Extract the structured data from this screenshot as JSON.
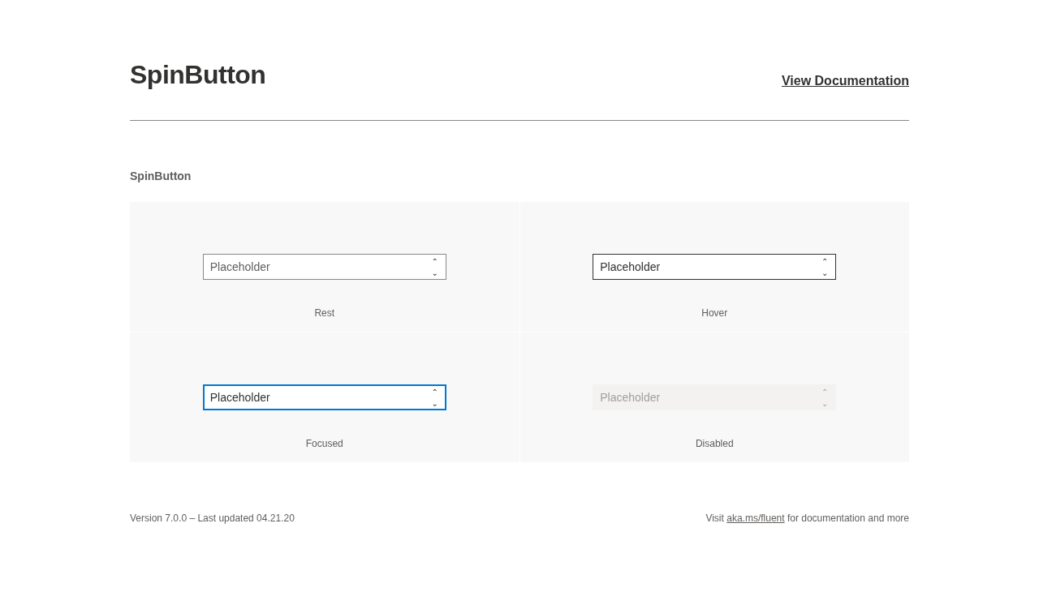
{
  "header": {
    "title": "SpinButton",
    "doc_link": "View Documentation"
  },
  "section_label": "SpinButton",
  "examples": [
    {
      "kind": "rest",
      "placeholder": "Placeholder",
      "up": "⌃",
      "down": "⌄",
      "caption": "Rest"
    },
    {
      "kind": "hover",
      "placeholder": "Placeholder",
      "up": "⌃",
      "down": "⌄",
      "caption": "Hover"
    },
    {
      "kind": "focused",
      "placeholder": "Placeholder",
      "up": "⌃",
      "down": "⌄",
      "caption": "Focused"
    },
    {
      "kind": "disabled",
      "placeholder": "Placeholder",
      "up": "⌃",
      "down": "⌄",
      "caption": "Disabled"
    }
  ],
  "footer": {
    "version": "Version 7.0.0 – Last updated 04.21.20",
    "note_before": "Visit ",
    "note_link": "aka.ms/fluent",
    "note_after": " for documentation and more"
  }
}
